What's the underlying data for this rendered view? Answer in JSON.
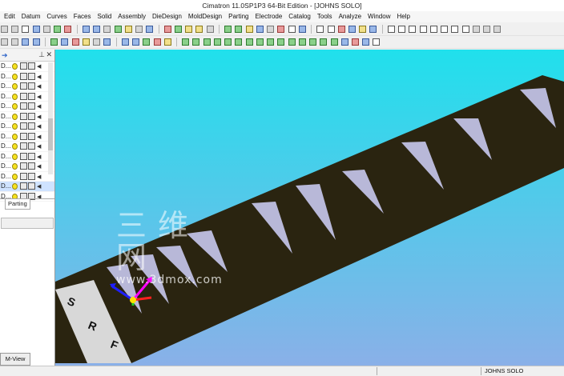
{
  "window": {
    "title": "Cimatron 11.0SP1P3 64-Bit Edition - [JOHNS SOLO]"
  },
  "menu": [
    "Edit",
    "Datum",
    "Curves",
    "Faces",
    "Solid",
    "Assembly",
    "DieDesign",
    "MoldDesign",
    "Parting",
    "Electrode",
    "Catalog",
    "Tools",
    "Analyze",
    "Window",
    "Help"
  ],
  "tree": {
    "rows": [
      "D...",
      "D...",
      "D...",
      "D...",
      "D...",
      "D...",
      "D...",
      "D...",
      "D...",
      "D...",
      "D...",
      "D...",
      "D...",
      "D..."
    ],
    "selected_index": 12
  },
  "tabs": {
    "parting": "Parting"
  },
  "viewport": {
    "part_letters": [
      "S",
      "R",
      "F"
    ],
    "colors": {
      "background_top": "#20e0ec",
      "background_bottom": "#8ab0e8",
      "part": "#2a2410",
      "spike": "#b8b8d8"
    }
  },
  "watermark": {
    "chinese": "三维网",
    "url": "www.3dmox.com"
  },
  "bottom": {
    "mview": "M-View"
  },
  "status": {
    "user": "JOHNS SOLO"
  }
}
